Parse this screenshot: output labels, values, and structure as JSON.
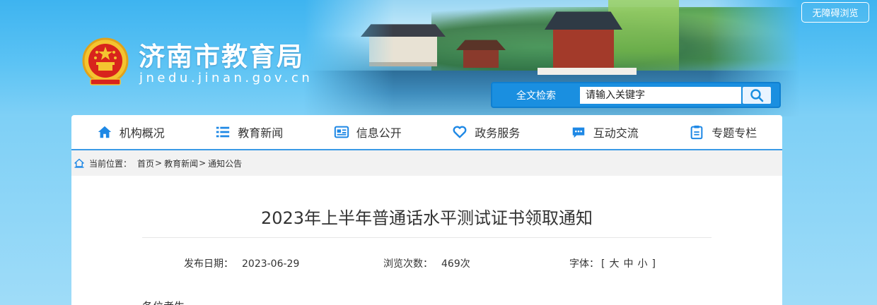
{
  "accessibility_label": "无障碍浏览",
  "site": {
    "title": "济南市教育局",
    "domain": "jnedu.jinan.gov.cn"
  },
  "search": {
    "label": "全文检索",
    "placeholder": "请输入关键字"
  },
  "nav": {
    "items": [
      {
        "label": "机构概况",
        "icon": "home-icon"
      },
      {
        "label": "教育新闻",
        "icon": "list-icon"
      },
      {
        "label": "信息公开",
        "icon": "newspaper-icon"
      },
      {
        "label": "政务服务",
        "icon": "heart-icon"
      },
      {
        "label": "互动交流",
        "icon": "chat-icon"
      },
      {
        "label": "专题专栏",
        "icon": "clipboard-icon"
      }
    ]
  },
  "breadcrumb": {
    "prefix": "当前位置：",
    "items": [
      "首页",
      "教育新闻",
      "通知公告"
    ],
    "separator": ">"
  },
  "article": {
    "title": "2023年上半年普通话水平测试证书领取通知",
    "publish_label": "发布日期：",
    "publish_date": "2023-06-29",
    "views_label": "浏览次数：",
    "views": "469次",
    "font_label": "字体：",
    "font_open": "[",
    "font_large": "大",
    "font_medium": "中",
    "font_small": "小",
    "font_close": "]",
    "body_start": "各位考生"
  },
  "colors": {
    "accent": "#1a8fe0",
    "nav_icon": "#1e88e5",
    "background": "#6ccaf5"
  }
}
